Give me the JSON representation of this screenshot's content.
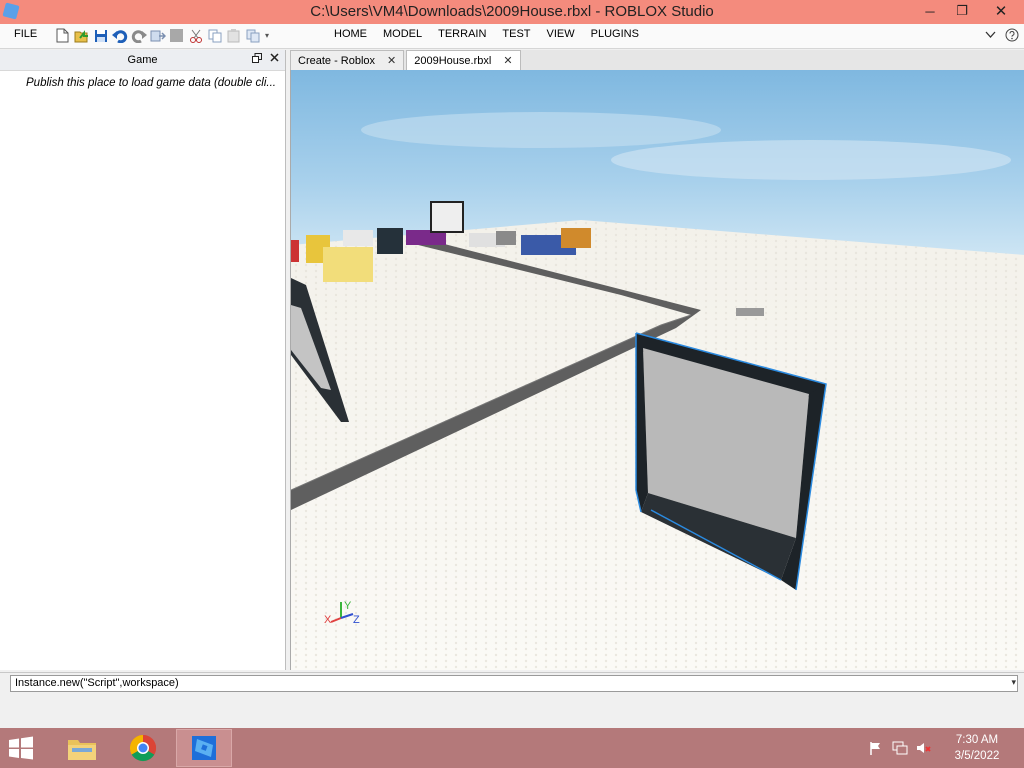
{
  "window": {
    "title": "C:\\Users\\VM4\\Downloads\\2009House.rbxl - ROBLOX Studio",
    "minimize": "─",
    "restore": "❐",
    "close": "✕"
  },
  "menubar": {
    "file_label": "FILE",
    "tabs": [
      "HOME",
      "MODEL",
      "TERRAIN",
      "TEST",
      "VIEW",
      "PLUGINS"
    ]
  },
  "game_panel": {
    "title": "Game",
    "message": "Publish this place to load game data (double cli..."
  },
  "doc_tabs": [
    {
      "label": "Create - Roblox",
      "active": false
    },
    {
      "label": "2009House.rbxl",
      "active": true
    }
  ],
  "viewport": {
    "axis_x": "X",
    "axis_y": "Y",
    "axis_z": "Z"
  },
  "command_bar": {
    "value": "Instance.new(\"Script\",workspace)"
  },
  "taskbar": {
    "time": "7:30 AM",
    "date": "3/5/2022"
  },
  "colors": {
    "titlebar": "#f48b7d",
    "taskbar": "#b4797a",
    "accent": "#1e6fd9"
  }
}
